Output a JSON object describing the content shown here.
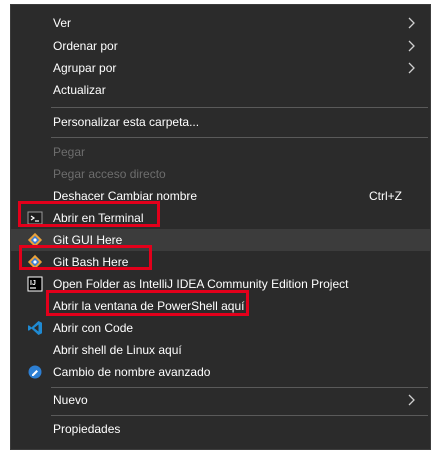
{
  "menu": {
    "items": [
      {
        "label": "Ver"
      },
      {
        "label": "Ordenar por"
      },
      {
        "label": "Agrupar por"
      },
      {
        "label": "Actualizar"
      },
      {
        "label": "Personalizar esta carpeta..."
      },
      {
        "label": "Pegar"
      },
      {
        "label": "Pegar acceso directo"
      },
      {
        "label": "Deshacer Cambiar nombre",
        "shortcut": "Ctrl+Z"
      },
      {
        "label": "Abrir en Terminal",
        "icon": "terminal-icon"
      },
      {
        "label": "Git GUI Here",
        "icon": "git-gui-icon"
      },
      {
        "label": "Git Bash Here",
        "icon": "git-bash-icon"
      },
      {
        "label": "Open Folder as IntelliJ IDEA Community Edition Project",
        "icon": "intellij-icon"
      },
      {
        "label": "Abrir la ventana de PowerShell aquí"
      },
      {
        "label": "Abrir con Code",
        "icon": "vscode-icon"
      },
      {
        "label": "Abrir shell de Linux aquí"
      },
      {
        "label": "Cambio de nombre avanzado",
        "icon": "rename-icon"
      },
      {
        "label": "Nuevo"
      },
      {
        "label": "Propiedades"
      }
    ]
  },
  "colors": {
    "menu_bg": "#2b2b2b",
    "highlight_bg": "#3c3c3c",
    "disabled_text": "#6d6d6d",
    "annotation_red": "#e3001b"
  }
}
